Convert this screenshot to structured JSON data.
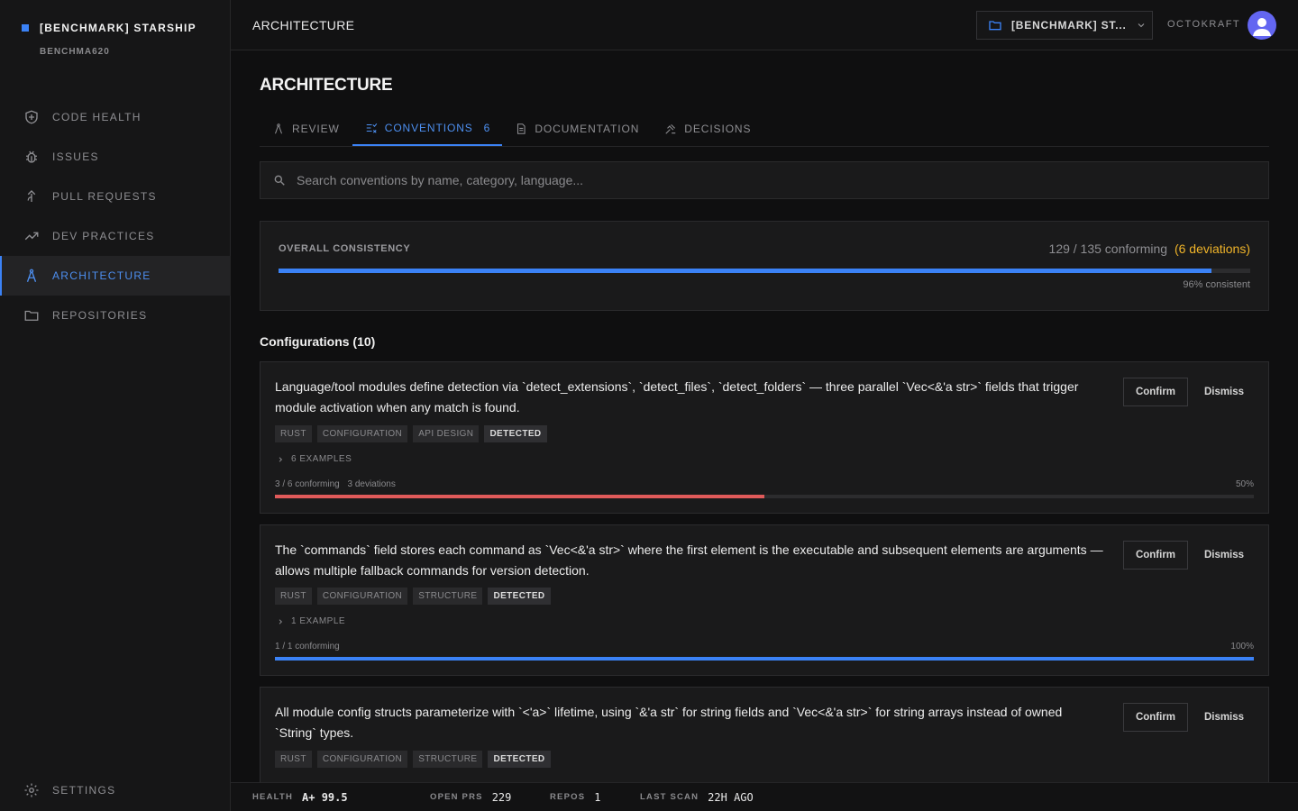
{
  "sidebar": {
    "brand_name": "[BENCHMARK] STARSHIP",
    "brand_sub": "BENCHMA620",
    "items": [
      {
        "label": "CODE HEALTH",
        "icon": "shield-icon"
      },
      {
        "label": "ISSUES",
        "icon": "bug-icon"
      },
      {
        "label": "PULL REQUESTS",
        "icon": "merge-icon"
      },
      {
        "label": "DEV PRACTICES",
        "icon": "trend-icon"
      },
      {
        "label": "ARCHITECTURE",
        "icon": "compass-icon",
        "active": true
      },
      {
        "label": "REPOSITORIES",
        "icon": "folder-icon"
      }
    ],
    "settings_label": "SETTINGS"
  },
  "header": {
    "title": "ARCHITECTURE",
    "repo_select": "[BENCHMARK] ST...",
    "org": "OCTOKRAFT"
  },
  "main": {
    "page_title": "ARCHITECTURE",
    "tabs": [
      {
        "label": "REVIEW"
      },
      {
        "label": "CONVENTIONS",
        "count": "6",
        "active": true
      },
      {
        "label": "DOCUMENTATION"
      },
      {
        "label": "DECISIONS"
      }
    ],
    "search_placeholder": "Search conventions by name, category, language...",
    "consistency": {
      "label": "OVERALL CONSISTENCY",
      "summary": "129 / 135 conforming",
      "deviations": "(6 deviations)",
      "percent_label": "96% consistent",
      "fraction": 0.96
    },
    "section_title": "Configurations (10)",
    "confirm_label": "Confirm",
    "dismiss_label": "Dismiss",
    "cards": [
      {
        "desc": "Language/tool modules define detection via `detect_extensions`, `detect_files`, `detect_folders` — three parallel `Vec<&'a str>` fields that trigger module activation when any match is found.",
        "tags": [
          "RUST",
          "CONFIGURATION",
          "API DESIGN"
        ],
        "status": "DETECTED",
        "examples": "6 EXAMPLES",
        "conforming": "3 / 6 conforming",
        "deviations": "3 deviations",
        "pct": "50%",
        "fraction": 0.5,
        "bar_color": "#e05a5a"
      },
      {
        "desc": "The `commands` field stores each command as `Vec<&'a str>` where the first element is the executable and subsequent elements are arguments — allows multiple fallback commands for version detection.",
        "tags": [
          "RUST",
          "CONFIGURATION",
          "STRUCTURE"
        ],
        "status": "DETECTED",
        "examples": "1 EXAMPLE",
        "conforming": "1 / 1 conforming",
        "deviations": "",
        "pct": "100%",
        "fraction": 1.0,
        "bar_color": "#3b82f6"
      },
      {
        "desc": "All module config structs parameterize with `<'a>` lifetime, using `&'a str` for string fields and `Vec<&'a str>` for string arrays instead of owned `String` types.",
        "tags": [
          "RUST",
          "CONFIGURATION",
          "STRUCTURE"
        ],
        "status": "DETECTED"
      }
    ]
  },
  "statusbar": {
    "health_k": "HEALTH",
    "health_v": "A+ 99.5",
    "prs_k": "OPEN PRS",
    "prs_v": "229",
    "repos_k": "REPOS",
    "repos_v": "1",
    "scan_k": "LAST SCAN",
    "scan_v": "22H AGO"
  },
  "colors": {
    "accent": "#3b82f6",
    "warning": "#f0b429",
    "danger": "#e05a5a"
  }
}
